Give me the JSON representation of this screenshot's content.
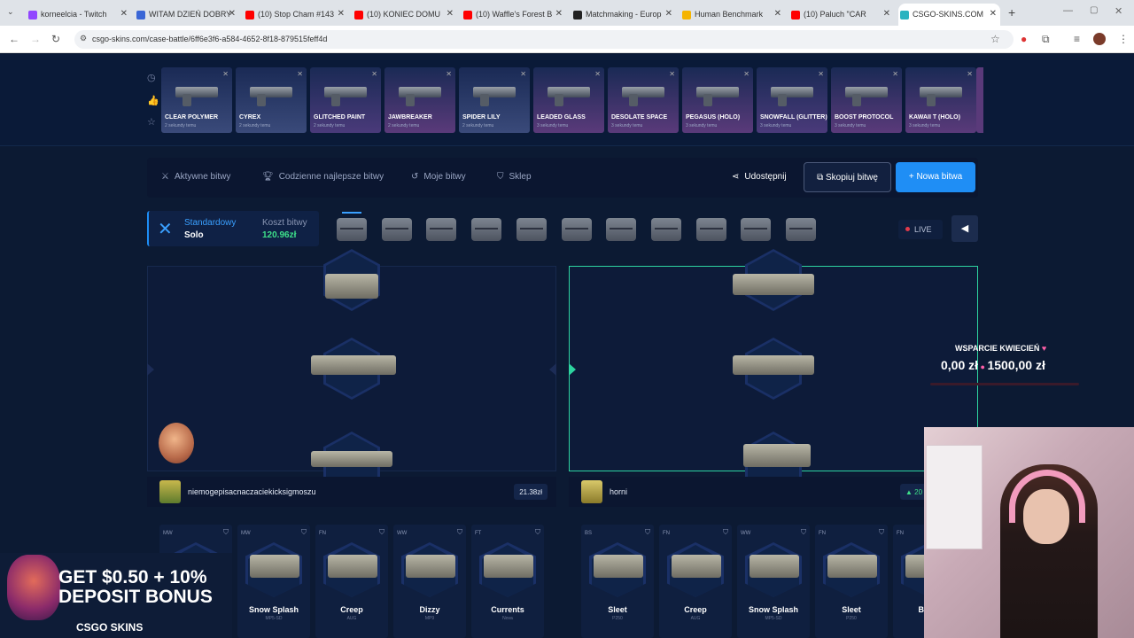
{
  "browser": {
    "tabs": [
      {
        "label": "korneelcia - Twitch",
        "color": "#9146ff"
      },
      {
        "label": "WITAM DZIEŃ DOBRY",
        "color": "#3a66d6"
      },
      {
        "label": "(10) Stop Cham #143",
        "color": "#ff0000"
      },
      {
        "label": "(10) KONIEC DOMU",
        "color": "#ff0000"
      },
      {
        "label": "(10) Waffle's Forest B",
        "color": "#ff0000"
      },
      {
        "label": "Matchmaking - Europ",
        "color": "#222222"
      },
      {
        "label": "Human Benchmark",
        "color": "#f5b400"
      },
      {
        "label": "(10) Paluch \"CAR",
        "color": "#ff0000"
      },
      {
        "label": "CSGO-SKINS.COM",
        "color": "#2bb3c0"
      }
    ],
    "url": "csgo-skins.com/case-battle/6ff6e3f6-a584-4652-8f18-879515feff4d"
  },
  "recent_drops": [
    {
      "name": "CLEAR POLYMER",
      "when": "2 sekundy temu",
      "color": "#3a4a7a"
    },
    {
      "name": "CYREX",
      "when": "2 sekundy temu",
      "color": "#3a4a7a"
    },
    {
      "name": "GLITCHED PAINT",
      "when": "2 sekundy temu",
      "color": "#4a3a7a"
    },
    {
      "name": "JAWBREAKER",
      "when": "2 sekundy temu",
      "color": "#5a3a7a"
    },
    {
      "name": "SPIDER LILY",
      "when": "2 sekundy temu",
      "color": "#3a4a7a"
    },
    {
      "name": "LEADED GLASS",
      "when": "3 sekundy temu",
      "color": "#5a3a7a"
    },
    {
      "name": "DESOLATE SPACE",
      "when": "3 sekundy temu",
      "color": "#5a3a7a"
    },
    {
      "name": "PEGASUS (HOLO)",
      "when": "3 sekundy temu",
      "color": "#5a3a7a"
    },
    {
      "name": "SNOWFALL (GLITTER)",
      "when": "3 sekundy temu",
      "color": "#4a3a7a"
    },
    {
      "name": "BOOST PROTOCOL",
      "when": "3 sekundy temu",
      "color": "#5a3a7a"
    },
    {
      "name": "KAWAII T (HOLO)",
      "when": "3 sekundy temu",
      "color": "#5a3a7a"
    }
  ],
  "nav": {
    "active": "Aktywne bitwy",
    "daily": "Codzienne najlepsze bitwy",
    "mine": "Moje bitwy",
    "shop": "Sklep",
    "share": "Udostępnij",
    "copy": "Skopiuj bitwę",
    "new": "Nowa bitwa"
  },
  "battle": {
    "mode": "Standardowy",
    "type": "Solo",
    "cost_label": "Koszt bitwy",
    "cost": "120.96zł",
    "live": "LIVE",
    "case_count": 11
  },
  "players": [
    {
      "name": "niemogepisacnaczaciekicksigmoszu",
      "value": "21.38zł"
    },
    {
      "name": "horni",
      "value": "20"
    }
  ],
  "items_left": [
    {
      "cond": "MW",
      "name": "",
      "sub": ""
    },
    {
      "cond": "MW",
      "name": "Snow Splash",
      "sub": "MP5-SD"
    },
    {
      "cond": "FN",
      "name": "Creep",
      "sub": "AUG"
    },
    {
      "cond": "WW",
      "name": "Dizzy",
      "sub": "MP9"
    },
    {
      "cond": "FT",
      "name": "Currents",
      "sub": "Nova"
    }
  ],
  "items_right": [
    {
      "cond": "BS",
      "name": "Sleet",
      "sub": "P250"
    },
    {
      "cond": "FN",
      "name": "Creep",
      "sub": "AUG"
    },
    {
      "cond": "WW",
      "name": "Snow Splash",
      "sub": "MP5-SD"
    },
    {
      "cond": "FN",
      "name": "Sleet",
      "sub": "P250"
    },
    {
      "cond": "FN",
      "name": "Break",
      "sub": ""
    }
  ],
  "overlay": {
    "donate_title": "WSPARCIE KWIECIEŃ",
    "donate_current": "0,00 zł",
    "donate_goal": "1500,00 zł",
    "ad_line1": "GET $0.50 + 10%",
    "ad_line2": "DEPOSIT BONUS",
    "ad_brand": "CSGO SKINS"
  }
}
